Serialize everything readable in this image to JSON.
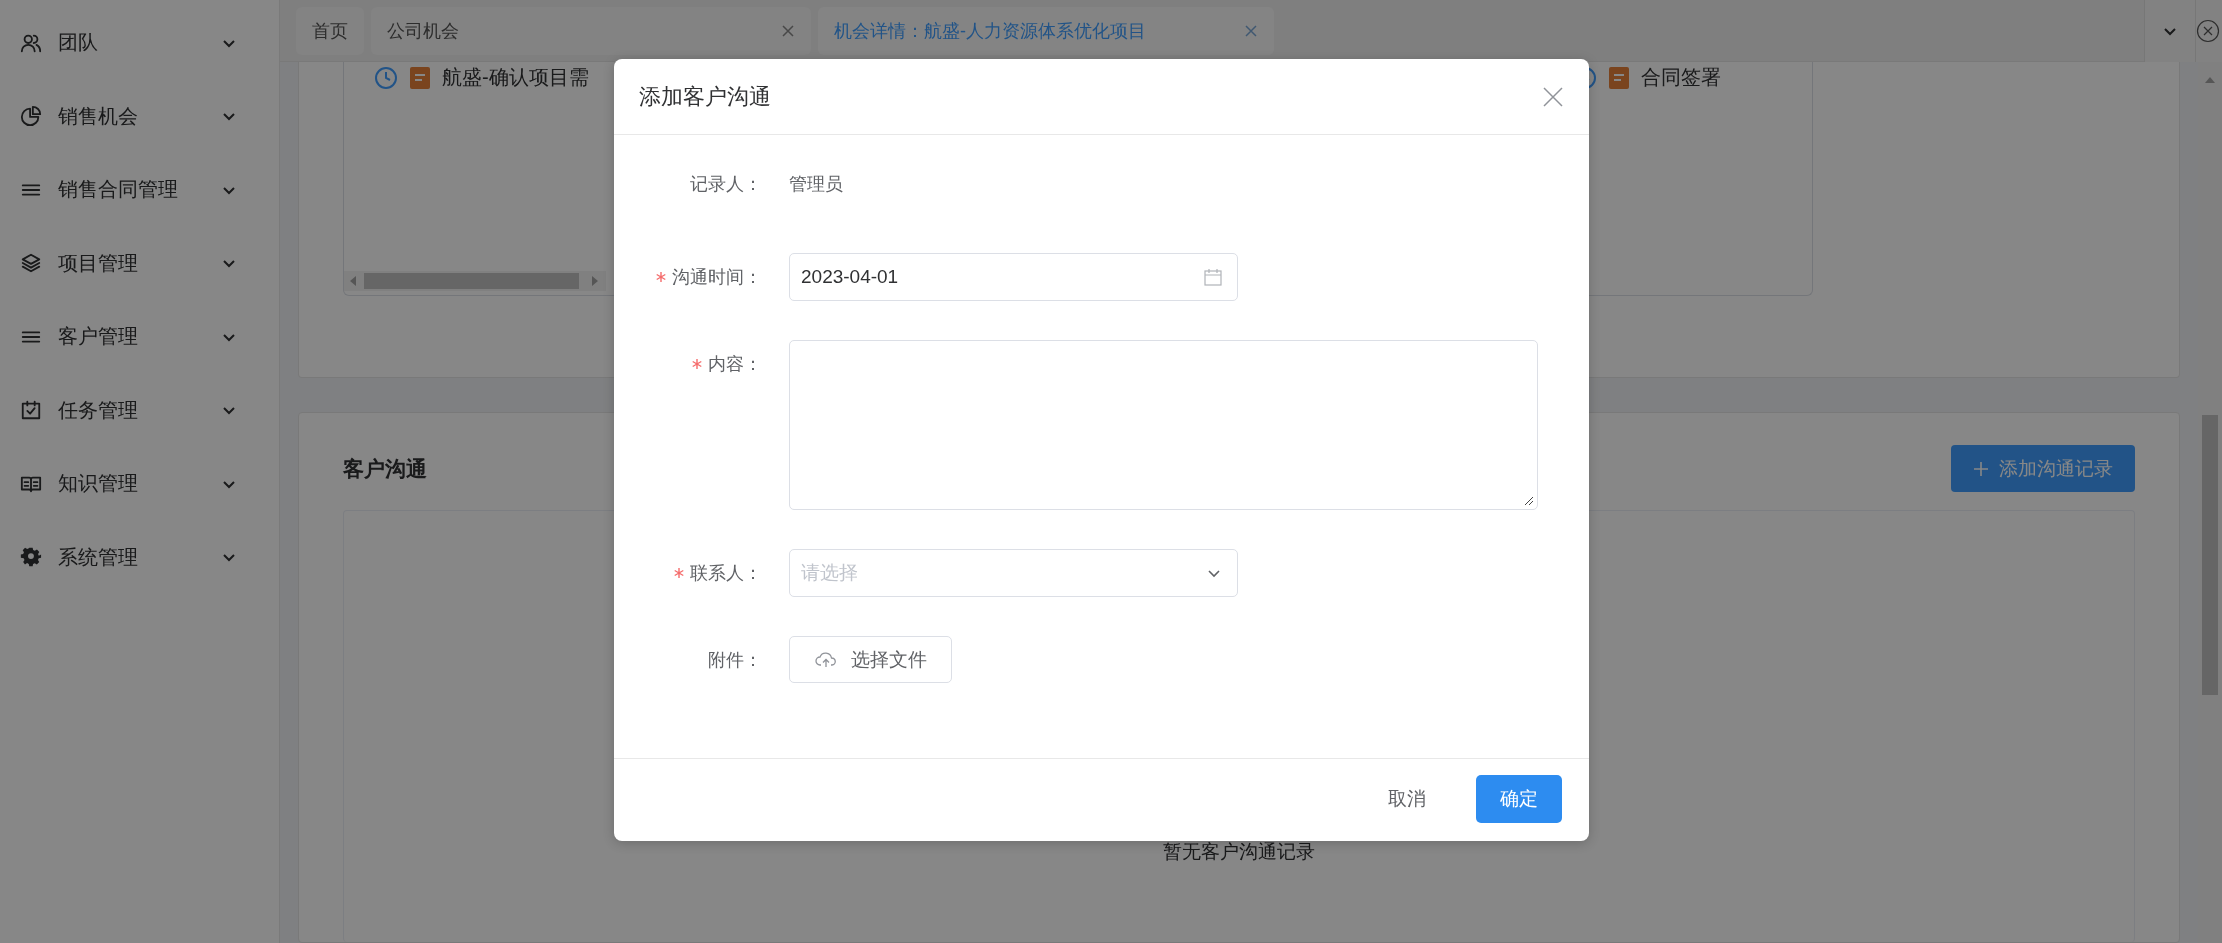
{
  "sidebar": {
    "items": [
      {
        "label": "团队",
        "expanded": false
      },
      {
        "label": "销售机会",
        "expanded": false
      },
      {
        "label": "销售合同管理",
        "expanded": false
      },
      {
        "label": "项目管理",
        "expanded": false
      },
      {
        "label": "客户管理",
        "expanded": false
      },
      {
        "label": "任务管理",
        "expanded": false
      },
      {
        "label": "知识管理",
        "expanded": false
      },
      {
        "label": "系统管理",
        "expanded": false
      }
    ]
  },
  "tabs": [
    {
      "label": "首页",
      "selected": false,
      "closable": false
    },
    {
      "label": "公司机会",
      "selected": false,
      "closable": true
    },
    {
      "label": "机会详情：航盛-人力资源体系优化项目",
      "selected": true,
      "closable": true
    }
  ],
  "timeline": {
    "items": [
      {
        "title": "航盛-确认项目需"
      },
      {
        "title": "合同签署"
      }
    ]
  },
  "communication": {
    "title": "客户沟通",
    "add_button": "添加沟通记录",
    "empty_text": "暂无客户沟通记录"
  },
  "dialog": {
    "title": "添加客户沟通",
    "fields": [
      {
        "kind": "text",
        "label": "记录人：",
        "required": false,
        "value": "管理员"
      },
      {
        "kind": "date",
        "label": "沟通时间：",
        "required": true,
        "value": "2023-04-01"
      },
      {
        "kind": "textarea",
        "label": "内容：",
        "required": true
      },
      {
        "kind": "select",
        "label": "联系人：",
        "required": true,
        "placeholder": "请选择"
      },
      {
        "kind": "upload",
        "label": "附件：",
        "required": false,
        "button": "选择文件"
      }
    ],
    "buttons": [
      {
        "kind": "text",
        "label": "取消"
      },
      {
        "kind": "primary",
        "label": "确定"
      }
    ]
  }
}
